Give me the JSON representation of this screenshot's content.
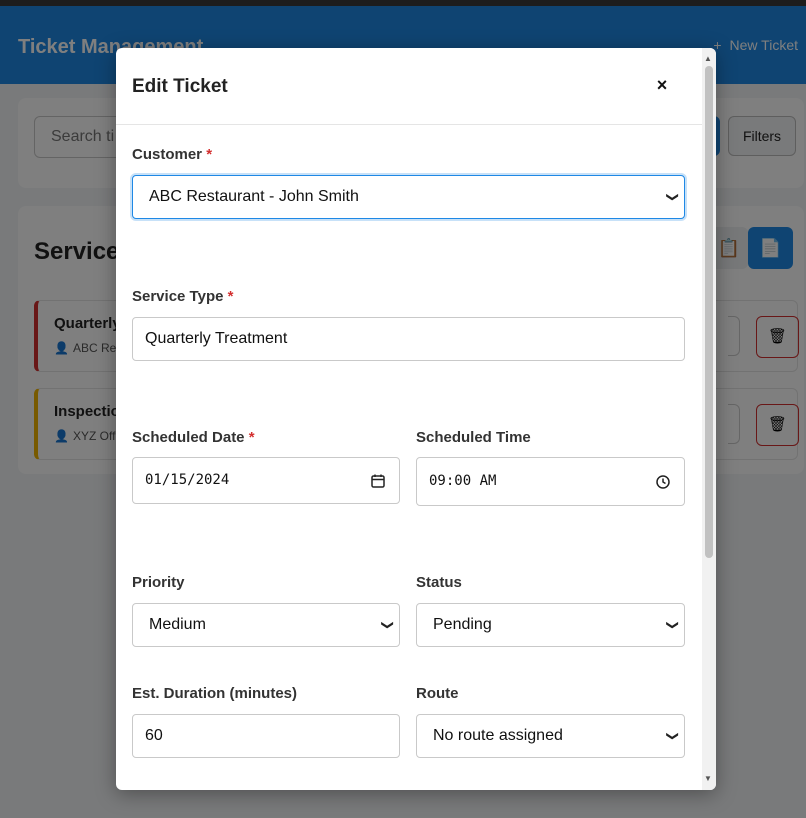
{
  "app": {
    "title": "Ticket Management",
    "new_ticket_label": "New Ticket",
    "search_placeholder": "Search ti",
    "filters_label": "Filters",
    "section_title": "Service",
    "tickets": [
      {
        "name": "Quarterly",
        "customer": "ABC Res"
      },
      {
        "name": "Inspectio",
        "customer": "XYZ Off"
      }
    ]
  },
  "modal": {
    "title": "Edit Ticket",
    "close_icon": "×",
    "required_marker": "*",
    "fields": {
      "customer": {
        "label": "Customer",
        "value": "ABC Restaurant - John Smith"
      },
      "service_type": {
        "label": "Service Type",
        "value": "Quarterly Treatment"
      },
      "scheduled_date": {
        "label": "Scheduled Date",
        "value": "01/15/2024"
      },
      "scheduled_time": {
        "label": "Scheduled Time",
        "value": "09:00 AM"
      },
      "priority": {
        "label": "Priority",
        "value": "Medium"
      },
      "status": {
        "label": "Status",
        "value": "Pending"
      },
      "duration": {
        "label": "Est. Duration (minutes)",
        "value": "60"
      },
      "route": {
        "label": "Route",
        "value": "No route assigned"
      }
    }
  },
  "colors": {
    "primary": "#1e88e5",
    "danger": "#d32f2f",
    "warning": "#f0b400"
  }
}
